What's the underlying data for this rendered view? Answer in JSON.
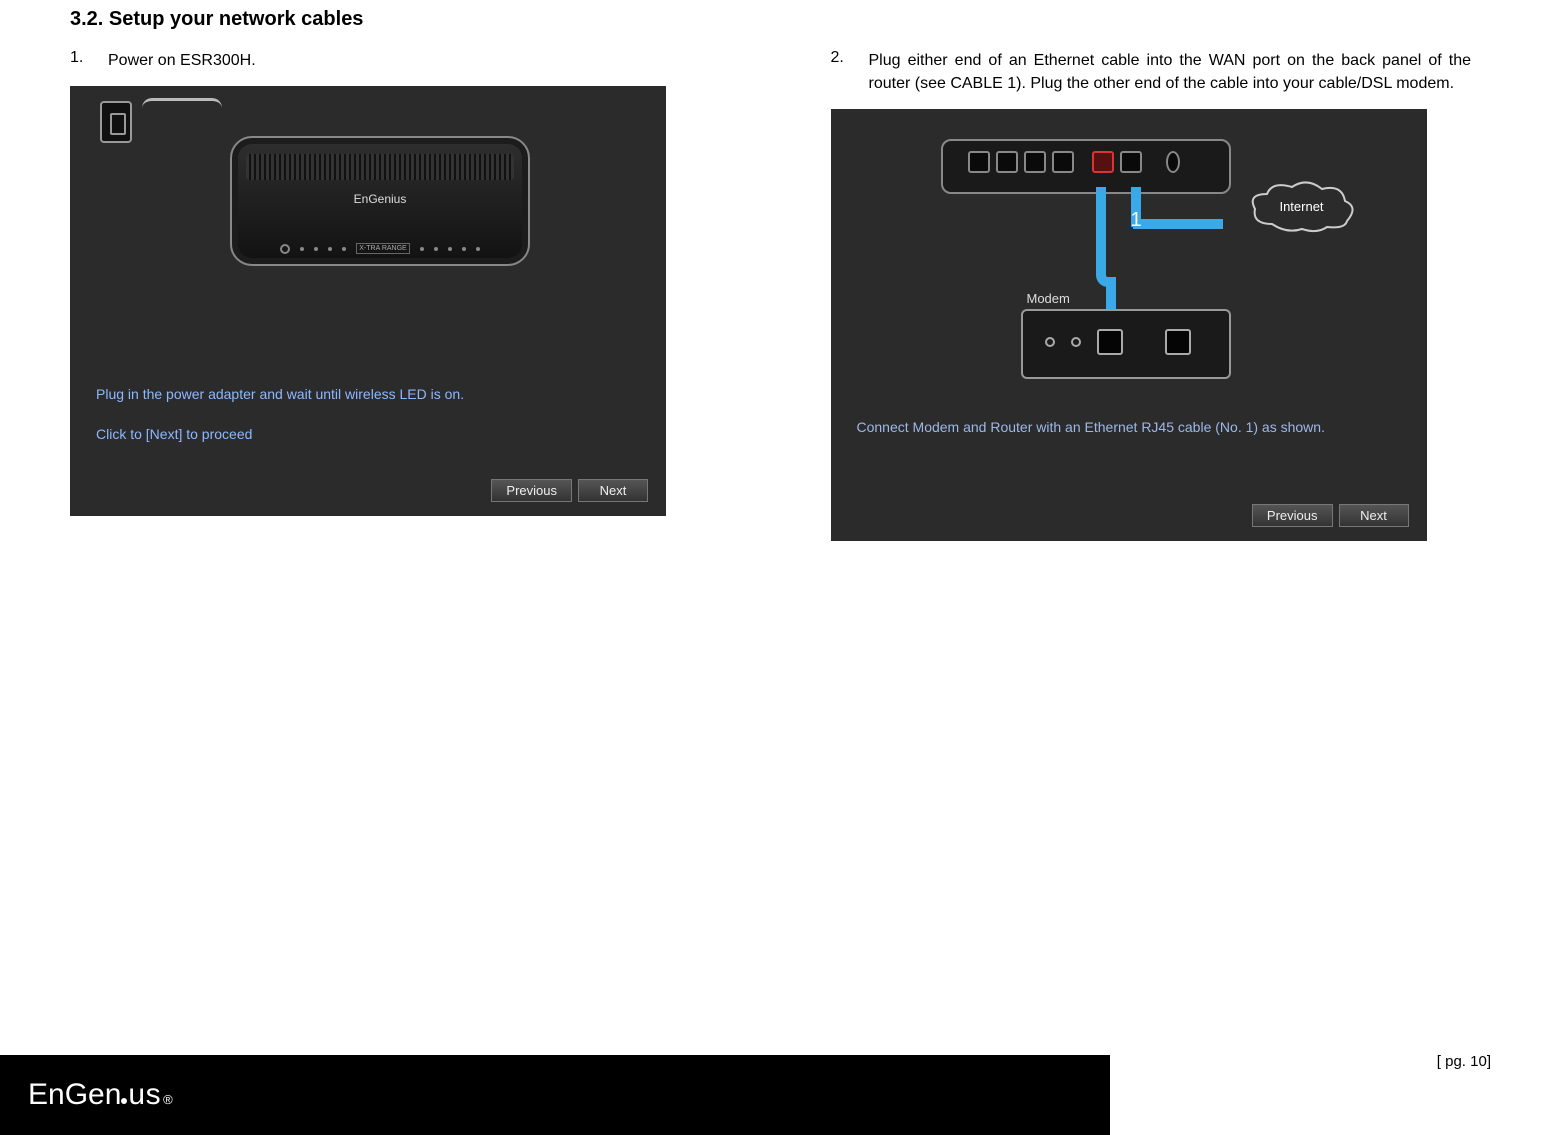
{
  "section": {
    "number": "3.2.",
    "title": "Setup your network cables"
  },
  "steps": [
    {
      "num": "1.",
      "text": "Power on ESR300H."
    },
    {
      "num": "2.",
      "text": "Plug either end of an Ethernet cable into the WAN port on the back panel of the router (see CABLE 1). Plug the other end of the cable into your cable/DSL modem."
    }
  ],
  "screenshot1": {
    "router_brand": "EnGenius",
    "xtra_label": "X-TRA RANGE",
    "instruction1": "Plug in the power adapter and wait until wireless LED is on.",
    "instruction2": "Click to [Next] to proceed",
    "prev": "Previous",
    "next": "Next"
  },
  "screenshot2": {
    "cable_num": "1",
    "cloud_label": "Internet",
    "modem_label": "Modem",
    "instruction": "Connect Modem and Router with an Ethernet RJ45 cable (No. 1) as shown.",
    "prev": "Previous",
    "next": "Next"
  },
  "footer": {
    "page_label": "[ pg. 10]",
    "logo_text1": "EnGen",
    "logo_text2": "us",
    "reg": "®"
  }
}
